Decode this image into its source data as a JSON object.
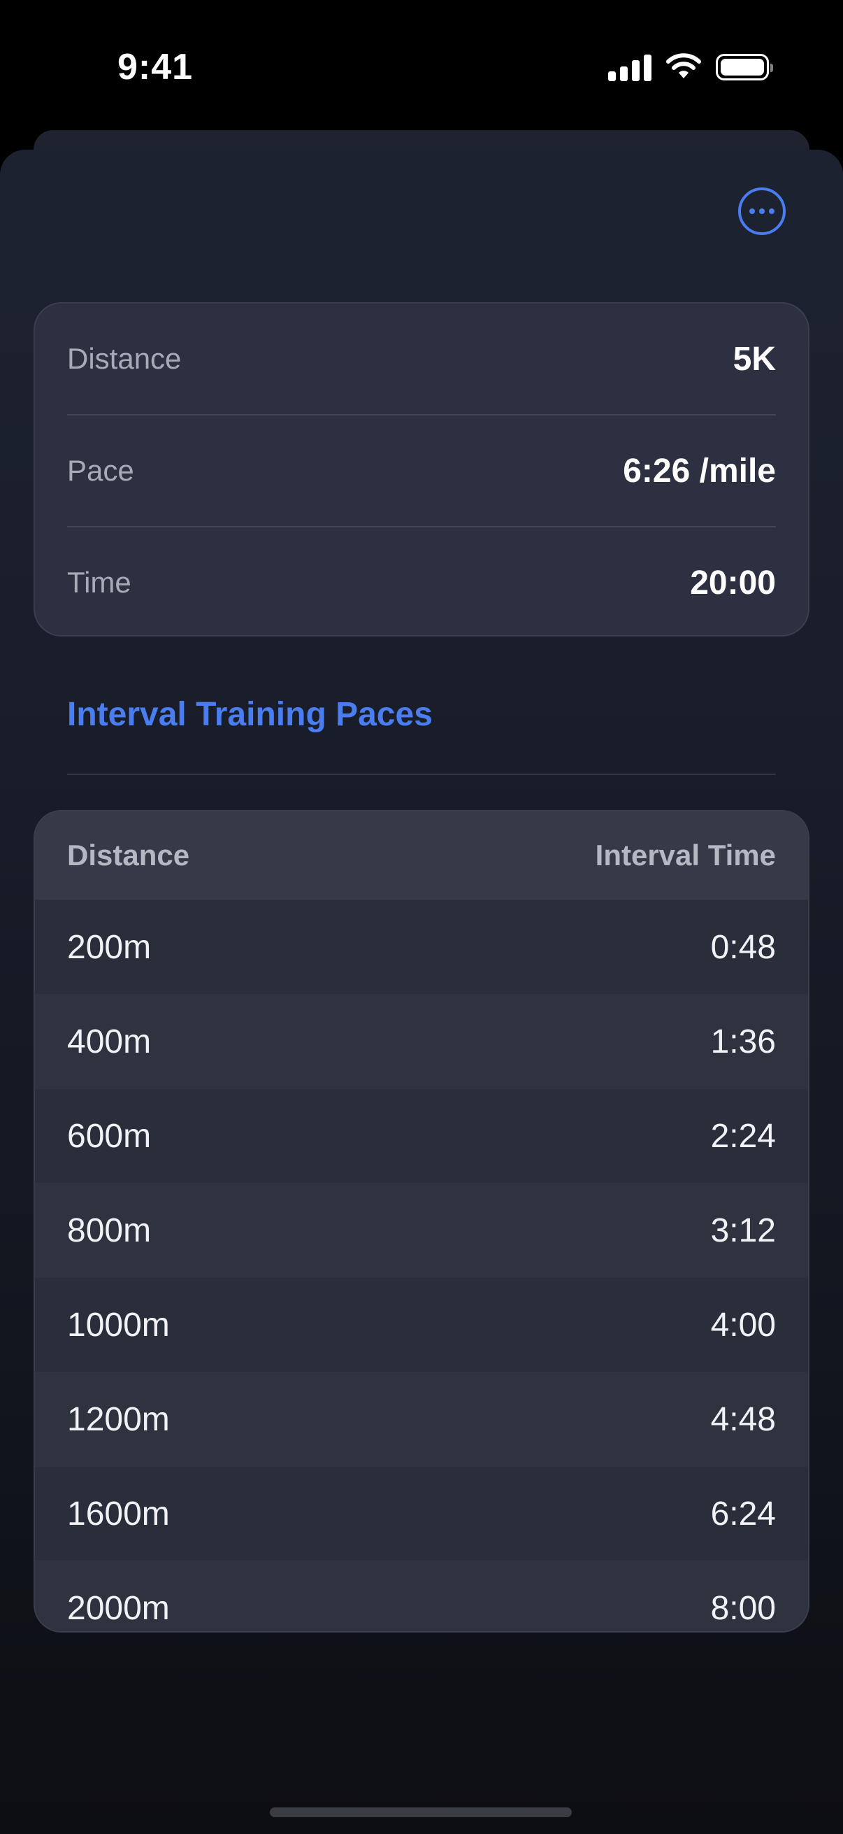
{
  "status_bar": {
    "time": "9:41"
  },
  "summary": {
    "rows": [
      {
        "label": "Distance",
        "value": "5K"
      },
      {
        "label": "Pace",
        "value": "6:26 /mile"
      },
      {
        "label": "Time",
        "value": "20:00"
      }
    ]
  },
  "section": {
    "title": "Interval Training Paces"
  },
  "table": {
    "headers": {
      "distance": "Distance",
      "time": "Interval Time"
    },
    "rows": [
      {
        "distance": "200m",
        "time": "0:48"
      },
      {
        "distance": "400m",
        "time": "1:36"
      },
      {
        "distance": "600m",
        "time": "2:24"
      },
      {
        "distance": "800m",
        "time": "3:12"
      },
      {
        "distance": "1000m",
        "time": "4:00"
      },
      {
        "distance": "1200m",
        "time": "4:48"
      },
      {
        "distance": "1600m",
        "time": "6:24"
      },
      {
        "distance": "2000m",
        "time": "8:00"
      }
    ]
  },
  "icons": {
    "more": "ellipsis-circle-icon",
    "signal": "cellular-signal-icon",
    "wifi": "wifi-icon",
    "battery": "battery-icon"
  },
  "colors": {
    "accent": "#4a7ef0",
    "card": "#2c3040",
    "background": "#13161f"
  }
}
